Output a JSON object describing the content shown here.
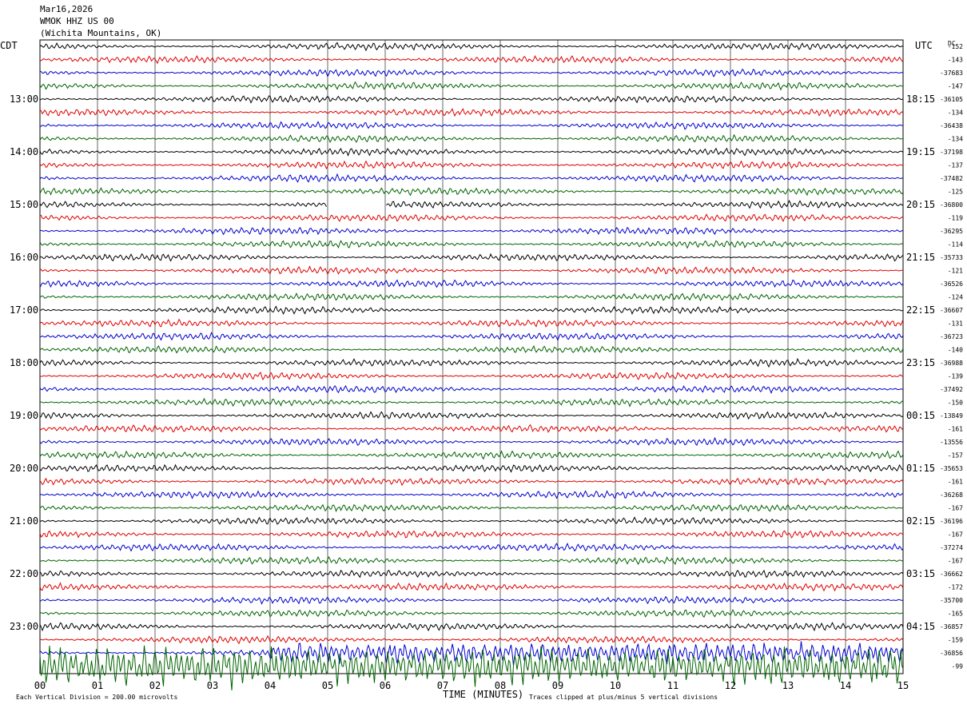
{
  "header": {
    "date": "Mar16,2026",
    "station": "WMOK HHZ US 00",
    "location": "(Wichita Mountains, OK)"
  },
  "left_axis_title": "CDT",
  "right_axis_title": "UTC",
  "dc_label": "DC",
  "left_time_labels": [
    "13:00",
    "14:00",
    "15:00",
    "16:00",
    "17:00",
    "18:00",
    "19:00",
    "20:00",
    "21:00",
    "22:00",
    "23:00"
  ],
  "right_time_labels": [
    "18:15",
    "19:15",
    "20:15",
    "21:15",
    "22:15",
    "23:15",
    "00:15",
    "01:15",
    "02:15",
    "03:15",
    "04:15"
  ],
  "dc_values": [
    "-152",
    "-143",
    "-37683",
    "-147",
    "-36105",
    "-134",
    "-36438",
    "-134",
    "-37198",
    "-137",
    "-37482",
    "-125",
    "-36800",
    "-119",
    "-36295",
    "-114",
    "-35733",
    "-121",
    "-36526",
    "-124",
    "-36607",
    "-131",
    "-36723",
    "-140",
    "-36988",
    "-139",
    "-37492",
    "-150",
    "-13849",
    "-161",
    "-13556",
    "-157",
    "-35653",
    "-161",
    "-36268",
    "-167",
    "-36196",
    "-167",
    "-37274",
    "-167",
    "-36662",
    "-172",
    "-35700",
    "-165",
    "-36857",
    "-159",
    "-36856",
    "-99"
  ],
  "footer": {
    "scale_note": "Each Vertical Division =  200.00 microvolts",
    "xlabel": "TIME (MINUTES)",
    "clip_note": "Traces clipped at plus/minus 5 vertical divisions"
  },
  "colors": {
    "trace_cycle": [
      "#000000",
      "#e00000",
      "#0000d0",
      "#006400"
    ],
    "grid": "#000000",
    "background": "#ffffff"
  },
  "chart_data": {
    "type": "line",
    "title": "WMOK HHZ US 00 (Wichita Mountains, OK) Mar16,2026",
    "xlabel": "TIME (MINUTES)",
    "x_ticks": [
      "00",
      "01",
      "02",
      "03",
      "04",
      "05",
      "06",
      "07",
      "08",
      "09",
      "10",
      "11",
      "12",
      "13",
      "14",
      "15"
    ],
    "xlim": [
      0,
      15
    ],
    "trace_count": 48,
    "trace_length_minutes": 15,
    "data_gap": {
      "trace_index": 12,
      "start_minute": 5,
      "end_minute": 6
    },
    "high_activity": [
      {
        "trace_index": 46,
        "start_minute": 4,
        "end_minute": 15
      },
      {
        "trace_index": 47,
        "start_minute": 0,
        "end_minute": 15
      }
    ],
    "clipping": "Traces clipped at plus/minus 5 vertical divisions",
    "vertical_division": "200.00 microvolts"
  }
}
